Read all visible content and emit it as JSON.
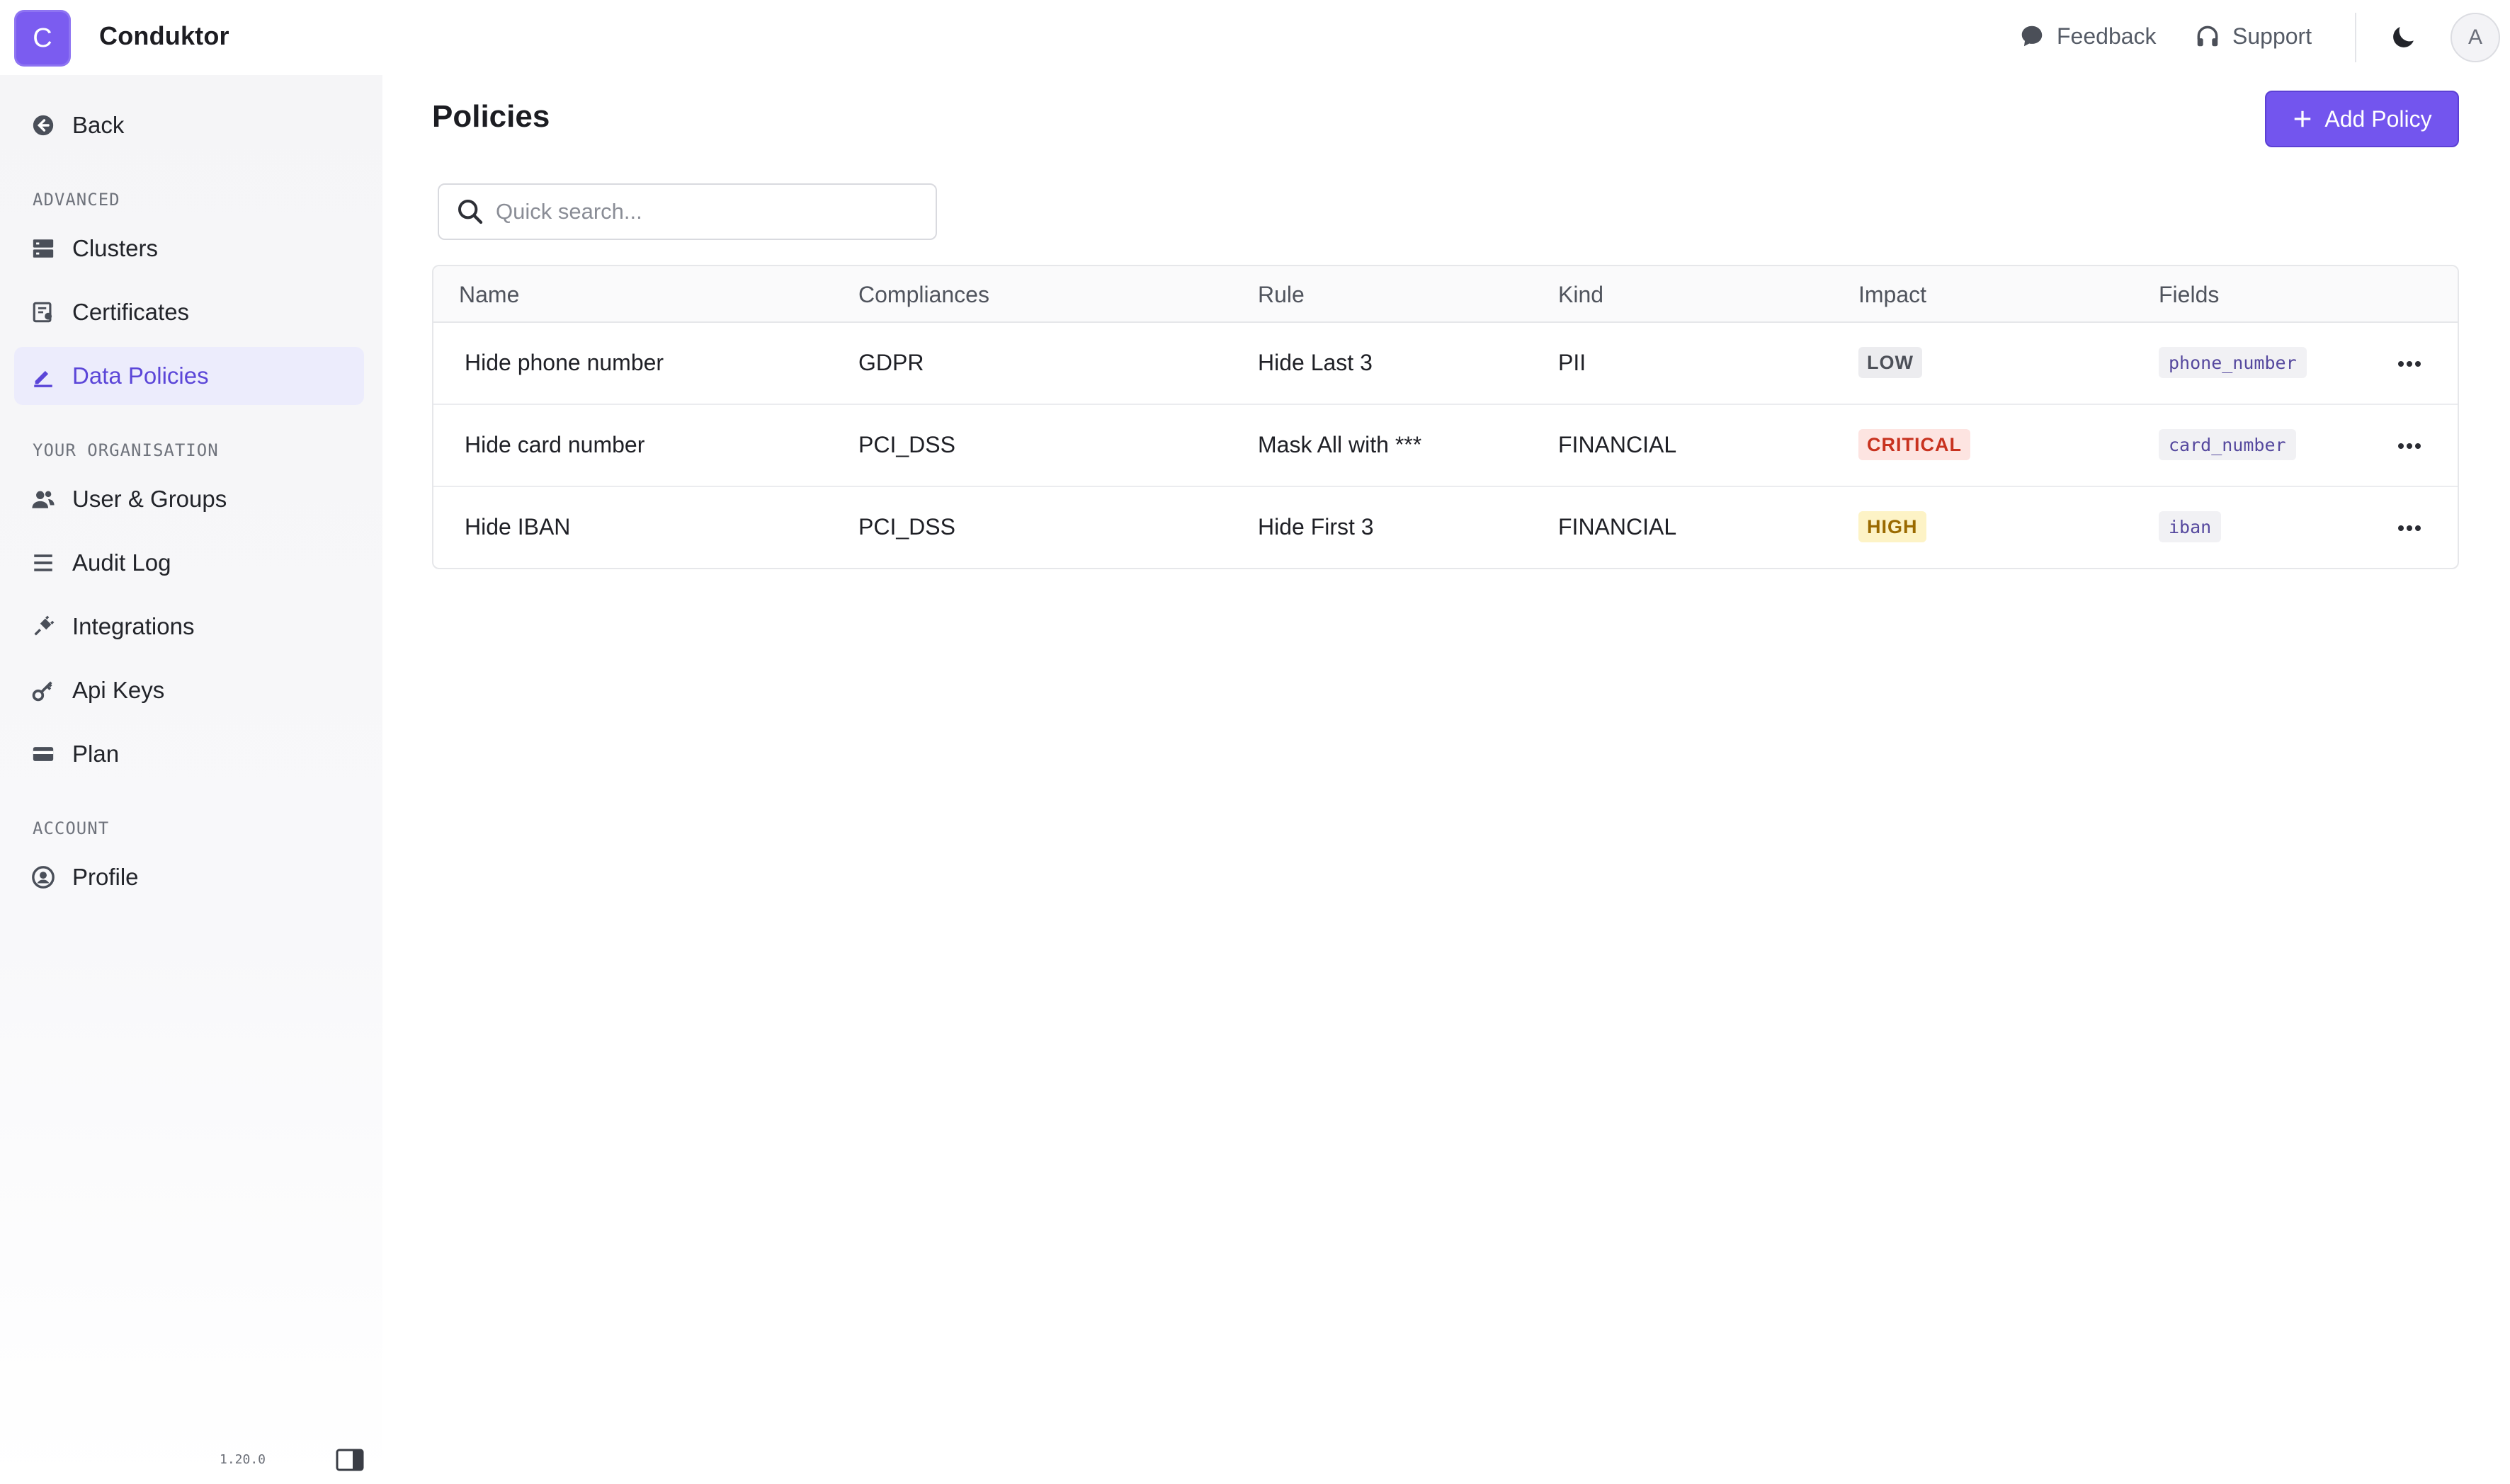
{
  "header": {
    "logo_letter": "C",
    "app_title": "Conduktor",
    "feedback_label": "Feedback",
    "support_label": "Support",
    "avatar_letter": "A"
  },
  "sidebar": {
    "back_label": "Back",
    "sections": [
      {
        "label": "ADVANCED",
        "items": [
          {
            "label": "Clusters",
            "icon": "server-icon"
          },
          {
            "label": "Certificates",
            "icon": "certificate-icon"
          },
          {
            "label": "Data Policies",
            "icon": "policy-icon",
            "active": true
          }
        ]
      },
      {
        "label": "YOUR ORGANISATION",
        "items": [
          {
            "label": "User & Groups",
            "icon": "users-icon"
          },
          {
            "label": "Audit Log",
            "icon": "list-icon"
          },
          {
            "label": "Integrations",
            "icon": "plug-icon"
          },
          {
            "label": "Api Keys",
            "icon": "key-icon"
          },
          {
            "label": "Plan",
            "icon": "credit-card-icon"
          }
        ]
      },
      {
        "label": "ACCOUNT",
        "items": [
          {
            "label": "Profile",
            "icon": "user-circle-icon"
          }
        ]
      }
    ],
    "version": "1.20.0"
  },
  "main": {
    "title": "Policies",
    "add_button_label": "Add Policy",
    "search_placeholder": "Quick search...",
    "table": {
      "columns": [
        "Name",
        "Compliances",
        "Rule",
        "Kind",
        "Impact",
        "Fields"
      ],
      "rows": [
        {
          "name": "Hide phone number",
          "compliance": "GDPR",
          "rule": "Hide Last 3",
          "kind": "PII",
          "impact": "LOW",
          "field": "phone_number"
        },
        {
          "name": "Hide card number",
          "compliance": "PCI_DSS",
          "rule": "Mask All with ***",
          "kind": "FINANCIAL",
          "impact": "CRITICAL",
          "field": "card_number"
        },
        {
          "name": "Hide IBAN",
          "compliance": "PCI_DSS",
          "rule": "Hide First 3",
          "kind": "FINANCIAL",
          "impact": "HIGH",
          "field": "iban"
        }
      ]
    }
  },
  "colors": {
    "accent": "#7355ee",
    "impact_low_bg": "#ececef",
    "impact_low_fg": "#4d5058",
    "impact_critical_bg": "#fde4e1",
    "impact_critical_fg": "#c8321f",
    "impact_high_bg": "#fdf3c6",
    "impact_high_fg": "#9a6a00"
  }
}
